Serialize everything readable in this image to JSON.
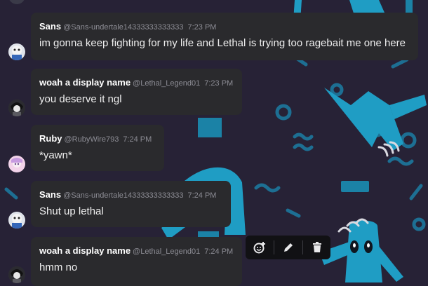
{
  "messages": [
    {
      "author": "Sans",
      "handle": "@Sans-undertale14333333333333",
      "time": "7:23 PM",
      "text": "im gonna keep fighting for my life and Lethal is trying too ragebait me one here"
    },
    {
      "author": "woah a display name",
      "handle": "@Lethal_Legend01",
      "time": "7:23 PM",
      "text": "you deserve it ngl"
    },
    {
      "author": "Ruby",
      "handle": "@RubyWire793",
      "time": "7:24 PM",
      "text": "*yawn*"
    },
    {
      "author": "Sans",
      "handle": "@Sans-undertale14333333333333",
      "time": "7:24 PM",
      "text": "Shut up lethal"
    },
    {
      "author": "woah a display name",
      "handle": "@Lethal_Legend01",
      "time": "7:24 PM",
      "text": "hmm no"
    }
  ],
  "toolbar": {
    "icons": [
      "add-reaction-icon",
      "edit-icon",
      "delete-icon"
    ]
  },
  "colors": {
    "background": "#272236",
    "bubble": "#2a2a2d",
    "accent_art": "#1f9dc4",
    "toolbar": "#111114"
  }
}
